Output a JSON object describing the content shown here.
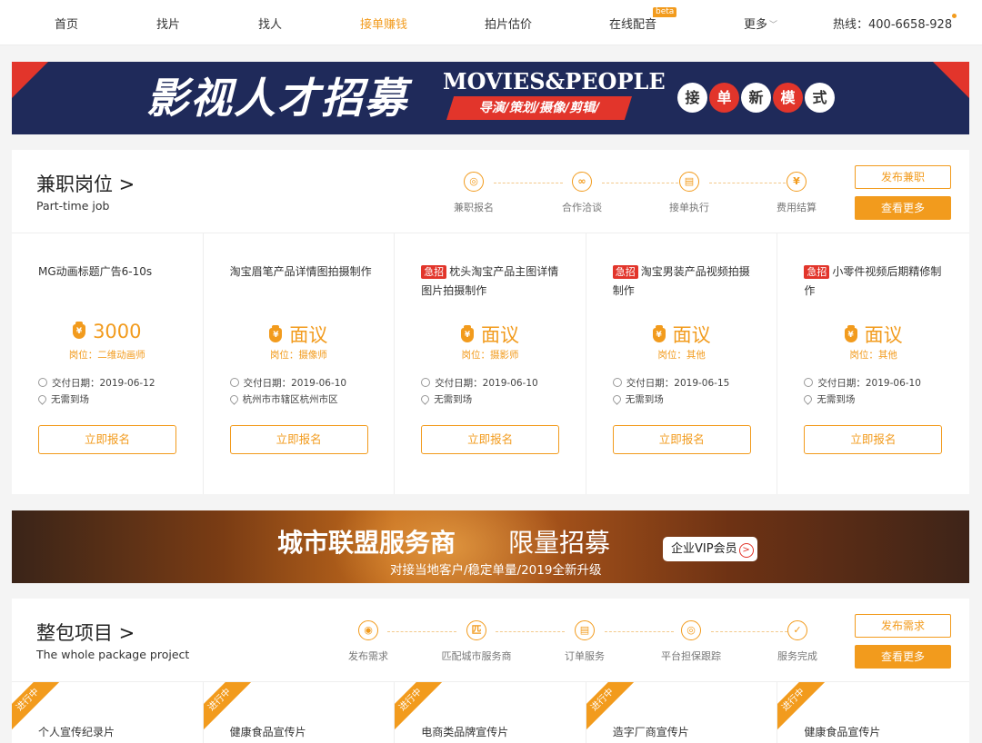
{
  "nav": {
    "items": [
      "首页",
      "找片",
      "找人",
      "接单赚钱",
      "拍片估价",
      "在线配音",
      "更多"
    ],
    "active_index": 3,
    "beta_label": "beta",
    "hotline": "热线：400-6658-928"
  },
  "banner_recruit": {
    "title": "影视人才招募",
    "en_title": "MOVIES&PEOPLE",
    "roles": "导演/策划/摄像/剪辑/",
    "mode_chars": [
      "接",
      "单",
      "新",
      "模",
      "式"
    ]
  },
  "parttime": {
    "title": "兼职岗位 >",
    "subtitle": "Part-time job",
    "steps": [
      "兼职报名",
      "合作洽谈",
      "接单执行",
      "费用结算"
    ],
    "publish_btn": "发布兼职",
    "more_btn": "查看更多",
    "urgent_label": "急招",
    "apply_label": "立即报名",
    "cards": [
      {
        "urgent": false,
        "title": "MG动画标题广告6-10s",
        "price": "3000",
        "role": "岗位：二维动画师",
        "date": "交付日期：2019-06-12",
        "location": "无需到场"
      },
      {
        "urgent": false,
        "title": "淘宝眉笔产品详情图拍摄制作",
        "price": "面议",
        "role": "岗位：摄像师",
        "date": "交付日期：2019-06-10",
        "location": "杭州市市辖区杭州市区"
      },
      {
        "urgent": true,
        "title": "枕头淘宝产品主图详情图片拍摄制作",
        "price": "面议",
        "role": "岗位：摄影师",
        "date": "交付日期：2019-06-10",
        "location": "无需到场"
      },
      {
        "urgent": true,
        "title": "淘宝男装产品视频拍摄制作",
        "price": "面议",
        "role": "岗位：其他",
        "date": "交付日期：2019-06-15",
        "location": "无需到场"
      },
      {
        "urgent": true,
        "title": "小零件视频后期精修制作",
        "price": "面议",
        "role": "岗位：其他",
        "date": "交付日期：2019-06-10",
        "location": "无需到场"
      }
    ]
  },
  "banner_city": {
    "title": "城市联盟服务商",
    "limited": "限量招募",
    "subtitle": "对接当地客户/稳定单量/2019全新升级",
    "vip_label": "企业VIP会员"
  },
  "package": {
    "title": "整包项目 >",
    "subtitle": "The whole package project",
    "steps": [
      "发布需求",
      "匹配城市服务商",
      "订单服务",
      "平台担保跟踪",
      "服务完成"
    ],
    "publish_btn": "发布需求",
    "more_btn": "查看更多",
    "status_label": "进行中",
    "cards": [
      "个人宣传纪录片",
      "健康食品宣传片",
      "电商类品牌宣传片",
      "造字厂商宣传片",
      "健康食品宣传片"
    ]
  },
  "icons": {
    "parttime_steps": [
      "person-icon",
      "handshake-icon",
      "document-icon",
      "yuan-icon"
    ],
    "package_steps": [
      "lightbulb-icon",
      "match-icon",
      "clipboard-icon",
      "target-icon",
      "check-icon"
    ]
  },
  "colors": {
    "accent": "#f29b1d",
    "urgent": "#e2352b",
    "banner_navy": "#1f2a5a"
  }
}
